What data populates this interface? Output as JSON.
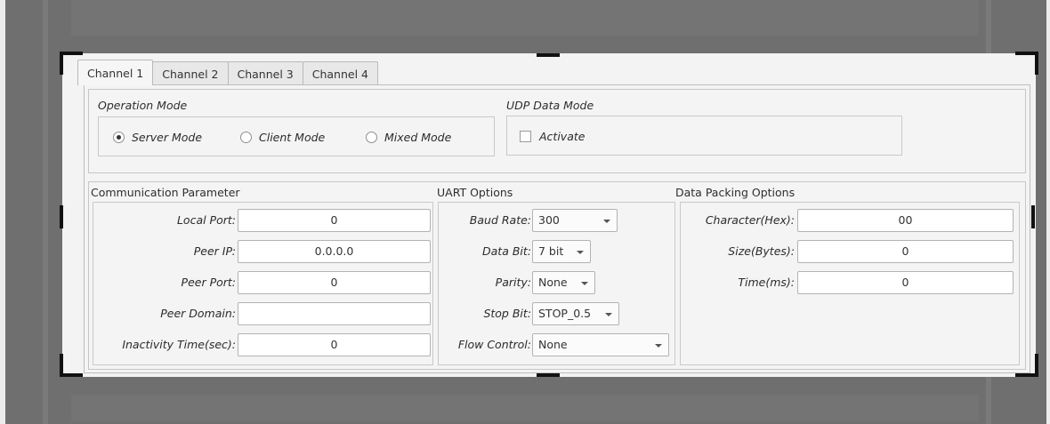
{
  "tabs": [
    "Channel 1",
    "Channel 2",
    "Channel 3",
    "Channel 4"
  ],
  "operation_mode": {
    "title": "Operation Mode",
    "options": [
      "Server Mode",
      "Client Mode",
      "Mixed Mode"
    ],
    "selected": "Server Mode"
  },
  "udp_mode": {
    "title": "UDP Data Mode",
    "activate_label": "Activate",
    "activate_checked": false
  },
  "communication": {
    "title": "Communication Parameter",
    "fields": [
      {
        "label": "Local Port:",
        "value": "0"
      },
      {
        "label": "Peer IP:",
        "value": "0.0.0.0"
      },
      {
        "label": "Peer Port:",
        "value": "0"
      },
      {
        "label": "Peer Domain:",
        "value": ""
      },
      {
        "label": "Inactivity Time(sec):",
        "value": "0"
      }
    ]
  },
  "uart": {
    "title": "UART Options",
    "fields": [
      {
        "label": "Baud Rate:",
        "value": "300"
      },
      {
        "label": "Data Bit:",
        "value": "7 bit"
      },
      {
        "label": "Parity:",
        "value": "None"
      },
      {
        "label": "Stop Bit:",
        "value": "STOP_0.5"
      },
      {
        "label": "Flow Control:",
        "value": "None"
      }
    ]
  },
  "packing": {
    "title": "Data Packing Options",
    "fields": [
      {
        "label": "Character(Hex):",
        "value": "00"
      },
      {
        "label": "Size(Bytes):",
        "value": "0"
      },
      {
        "label": "Time(ms):",
        "value": "0"
      }
    ]
  },
  "icons": {
    "dropdown": "chevron-down-icon",
    "radio": "radio-button-icon",
    "checkbox": "checkbox-icon"
  }
}
